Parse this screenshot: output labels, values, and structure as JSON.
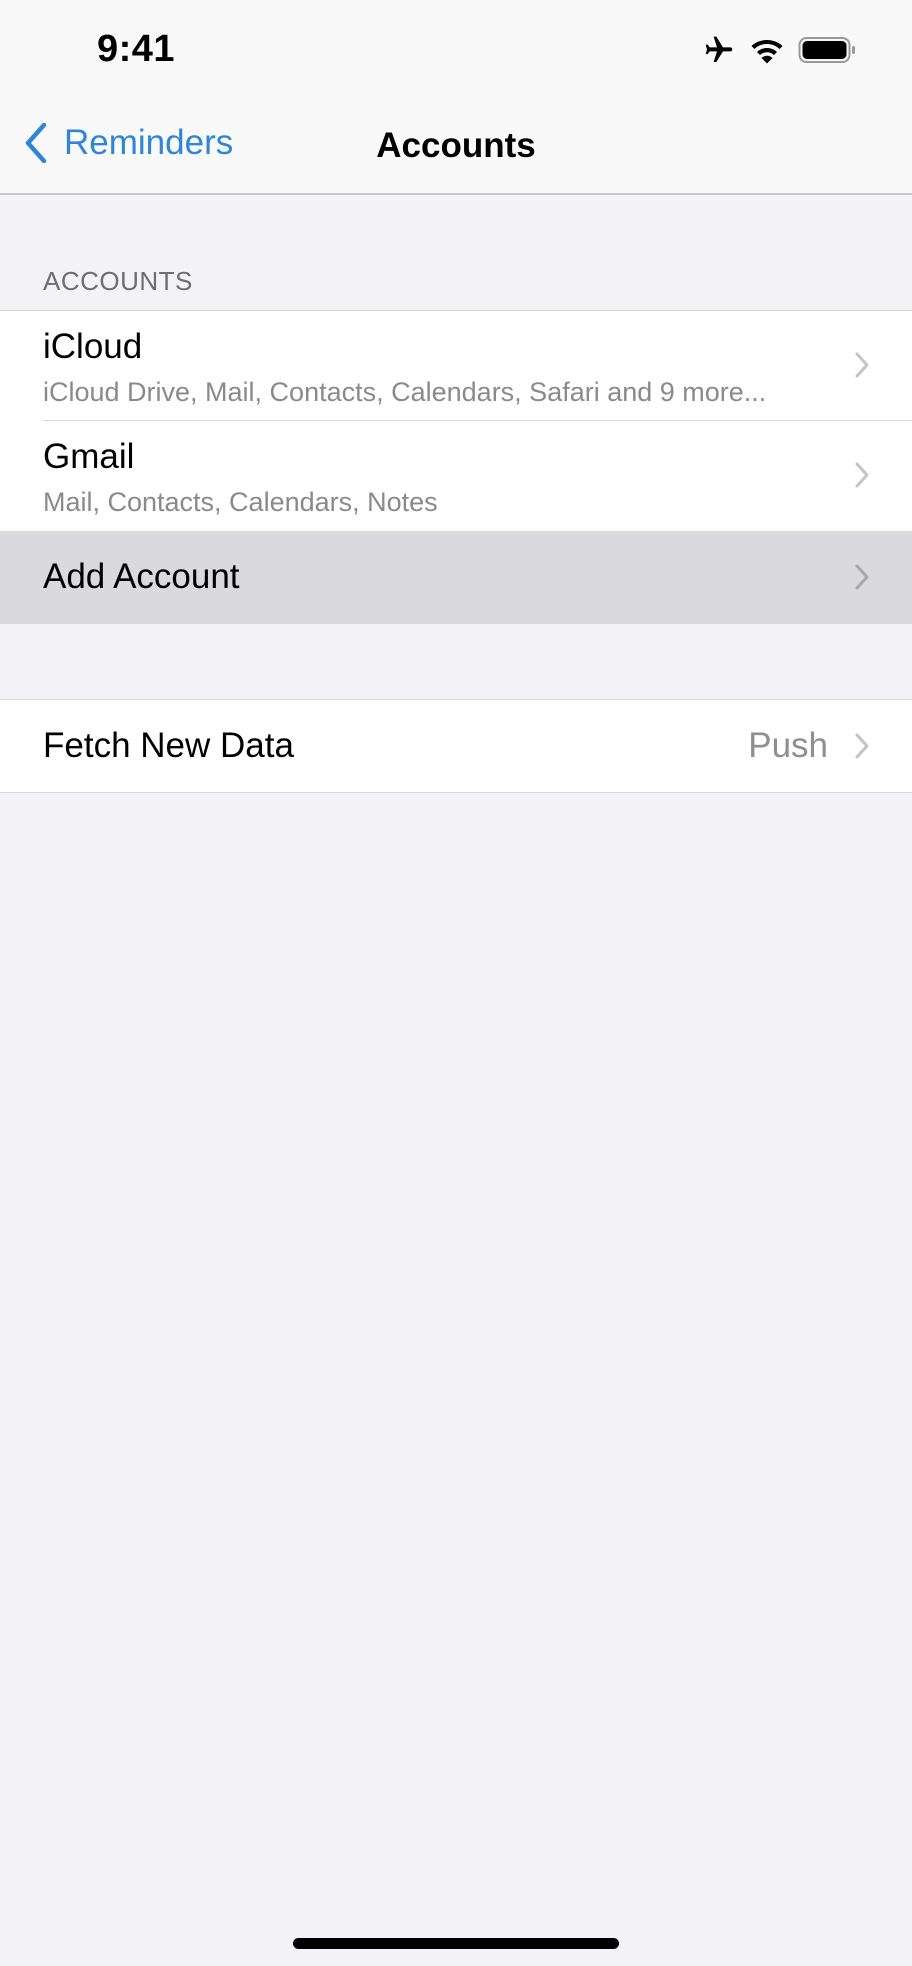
{
  "status_bar": {
    "time": "9:41",
    "icons": [
      "airplane-icon",
      "wifi-icon",
      "battery-icon"
    ]
  },
  "nav": {
    "back_label": "Reminders",
    "title": "Accounts"
  },
  "accounts_section": {
    "header": "ACCOUNTS",
    "items": [
      {
        "title": "iCloud",
        "subtitle": "iCloud Drive, Mail, Contacts, Calendars, Safari and 9 more..."
      },
      {
        "title": "Gmail",
        "subtitle": "Mail, Contacts, Calendars, Notes"
      },
      {
        "title": "Add Account"
      }
    ]
  },
  "fetch_section": {
    "title": "Fetch New Data",
    "value": "Push"
  },
  "colors": {
    "accent": "#2f86d8",
    "background": "#f2f2f7",
    "highlight": "#d9d9de"
  }
}
